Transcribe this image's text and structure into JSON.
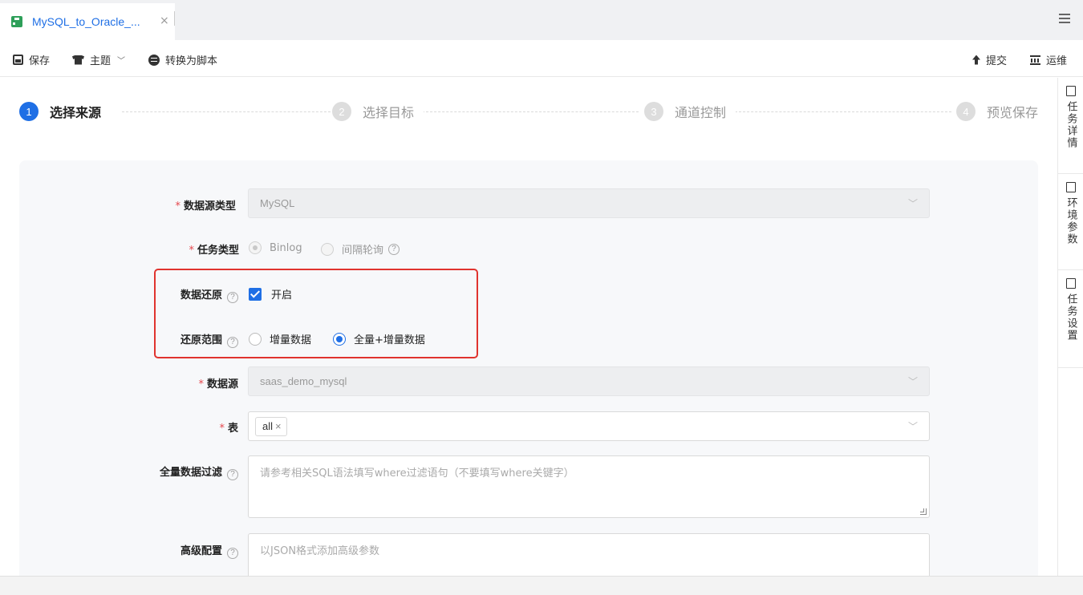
{
  "tab": {
    "title": "MySQL_to_Oracle_...",
    "close": "×"
  },
  "toolbar": {
    "save": "保存",
    "theme": "主题",
    "convert": "转换为脚本",
    "submit": "提交",
    "ops": "运维"
  },
  "steps": [
    {
      "num": "1",
      "label": "选择来源",
      "active": true
    },
    {
      "num": "2",
      "label": "选择目标",
      "active": false
    },
    {
      "num": "3",
      "label": "通道控制",
      "active": false
    },
    {
      "num": "4",
      "label": "预览保存",
      "active": false
    }
  ],
  "form": {
    "datasource_type": {
      "label": "数据源类型",
      "value": "MySQL"
    },
    "task_type": {
      "label": "任务类型",
      "options": [
        "Binlog",
        "间隔轮询"
      ]
    },
    "restore": {
      "label": "数据还原",
      "checkbox_label": "开启",
      "checked": true
    },
    "restore_scope": {
      "label": "还原范围",
      "options": [
        "增量数据",
        "全量+增量数据"
      ],
      "selected": "全量+增量数据"
    },
    "datasource": {
      "label": "数据源",
      "value": "saas_demo_mysql"
    },
    "table": {
      "label": "表",
      "tag": "all"
    },
    "full_filter": {
      "label": "全量数据过滤",
      "placeholder": "请参考相关SQL语法填写where过滤语句（不要填写where关键字）"
    },
    "advanced": {
      "label": "高级配置",
      "placeholder": "以JSON格式添加高级参数"
    }
  },
  "sidebar": {
    "items": [
      {
        "label": "任务详情",
        "icon": "document-icon"
      },
      {
        "label": "环境参数",
        "icon": "sliders-icon"
      },
      {
        "label": "任务设置",
        "icon": "edit-settings-icon"
      }
    ]
  },
  "colors": {
    "accent": "#1f6fe5",
    "highlight": "#e0332e",
    "required": "#e5484d"
  }
}
